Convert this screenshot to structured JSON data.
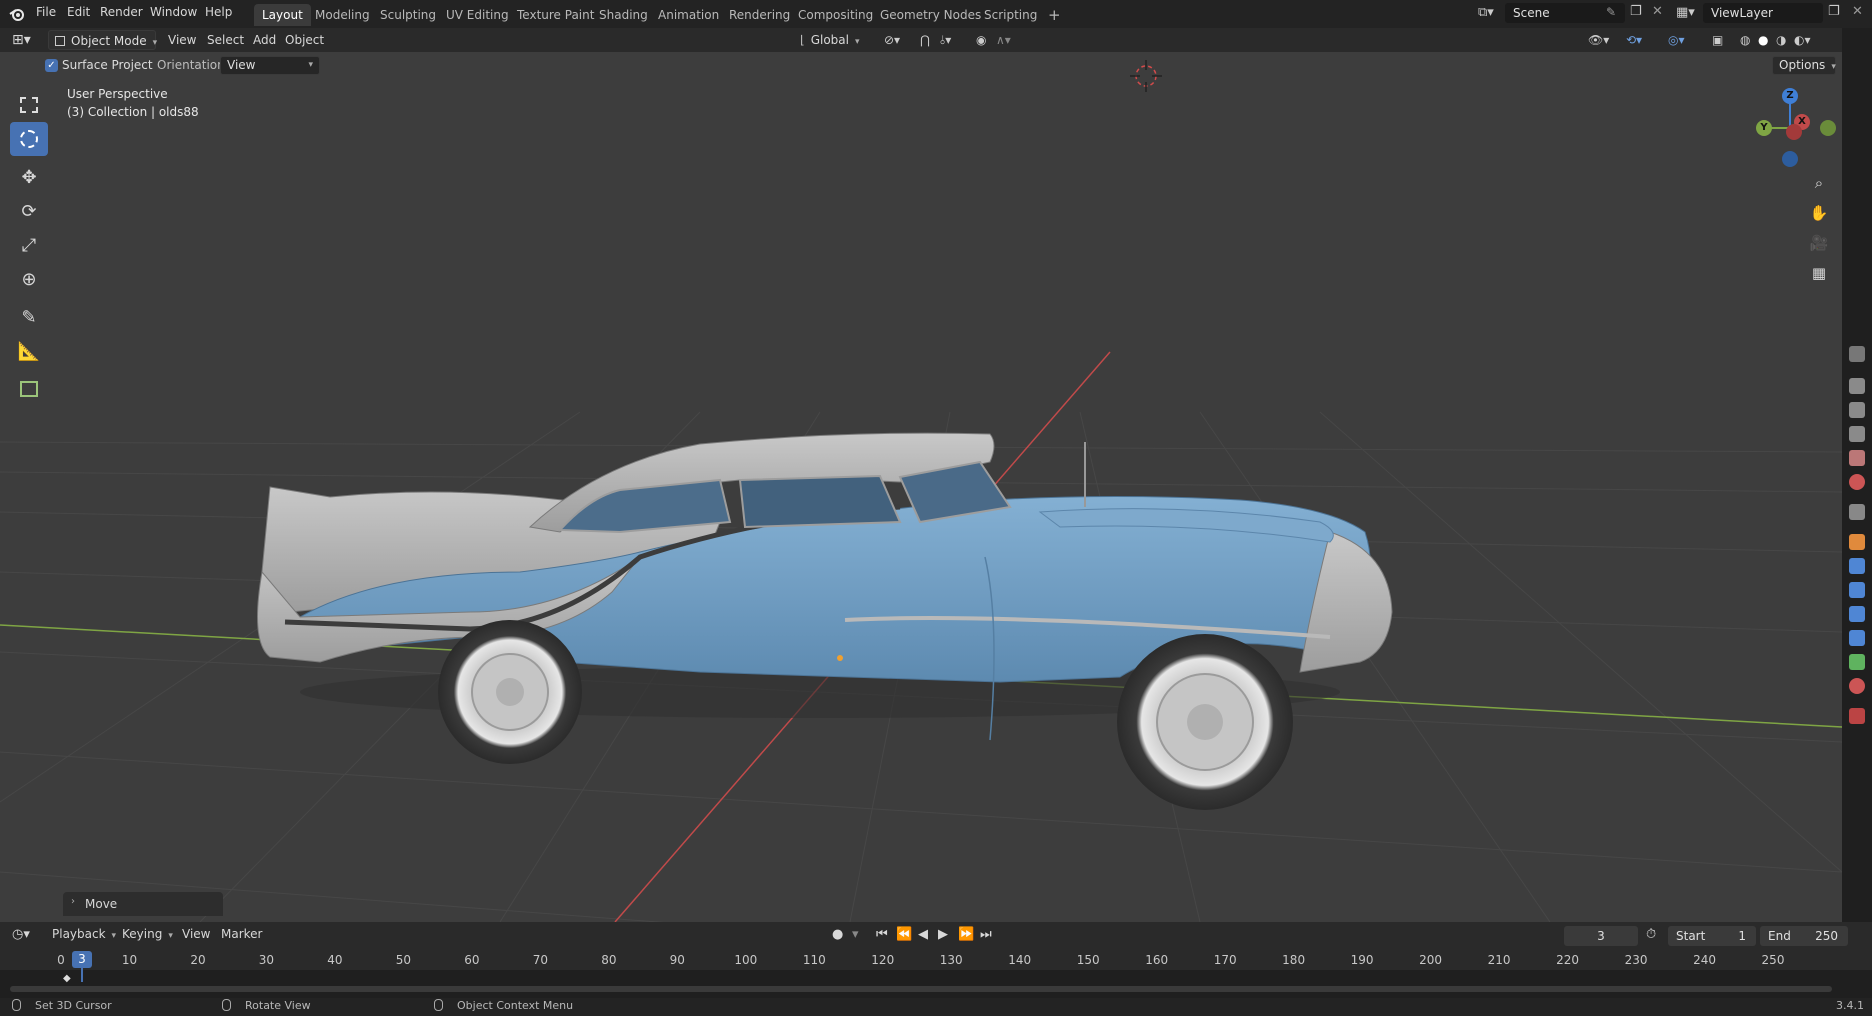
{
  "menu": {
    "items": [
      "File",
      "Edit",
      "Render",
      "Window",
      "Help"
    ]
  },
  "workspaces": [
    {
      "label": "Layout",
      "active": true
    },
    {
      "label": "Modeling",
      "active": false
    },
    {
      "label": "Sculpting",
      "active": false
    },
    {
      "label": "UV Editing",
      "active": false
    },
    {
      "label": "Texture Paint",
      "active": false
    },
    {
      "label": "Shading",
      "active": false
    },
    {
      "label": "Animation",
      "active": false
    },
    {
      "label": "Rendering",
      "active": false
    },
    {
      "label": "Compositing",
      "active": false
    },
    {
      "label": "Geometry Nodes",
      "active": false
    },
    {
      "label": "Scripting",
      "active": false
    }
  ],
  "add_workspace": "+",
  "scene": {
    "name": "Scene"
  },
  "view_layer": {
    "name": "ViewLayer"
  },
  "header": {
    "mode": "Object Mode",
    "view": "View",
    "select": "Select",
    "add": "Add",
    "object": "Object",
    "transform_orientation": "Global"
  },
  "tool_options": {
    "surface_project_label": "Surface Project",
    "surface_project_checked": true,
    "orientation_label": "Orientation:",
    "orientation_value": "View",
    "options_label": "Options"
  },
  "viewport": {
    "perspective_label": "User Perspective",
    "collection_label": "(3) Collection | olds88",
    "gizmo_axes": {
      "z": "Z",
      "y": "Y",
      "x": "X"
    }
  },
  "operator_panel": {
    "label": "Move"
  },
  "timeline": {
    "playback": "Playback",
    "keying": "Keying",
    "view": "View",
    "marker": "Marker",
    "current_frame": "3",
    "start_label": "Start",
    "start_value": "1",
    "end_label": "End",
    "end_value": "250",
    "frame_ticks": [
      "0",
      "10",
      "20",
      "30",
      "40",
      "50",
      "60",
      "70",
      "80",
      "90",
      "100",
      "110",
      "120",
      "130",
      "140",
      "150",
      "160",
      "170",
      "180",
      "190",
      "200",
      "210",
      "220",
      "230",
      "240",
      "250"
    ],
    "playhead": "3"
  },
  "status": {
    "left_click": "Set 3D Cursor",
    "middle_click": "Rotate View",
    "right_click": "Object Context Menu",
    "version": "3.4.1"
  },
  "colors": {
    "active_blue": "#4772b3",
    "car_body": "#6f9cc1",
    "car_top": "#bdbdbd",
    "axis_x": "#c04a4a",
    "axis_y": "#7fa544",
    "axis_z": "#3f7fd6"
  }
}
